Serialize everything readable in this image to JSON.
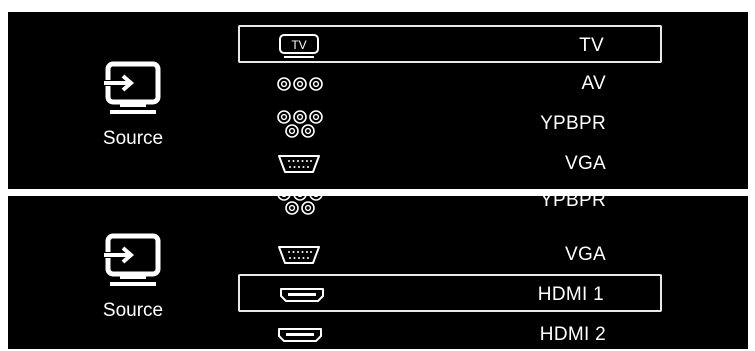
{
  "screens": [
    {
      "source_label": "Source",
      "items": [
        {
          "label": "TV",
          "icon": "tv-icon",
          "selected": true
        },
        {
          "label": "AV",
          "icon": "av-jacks-icon",
          "selected": false
        },
        {
          "label": "YPBPR",
          "icon": "ypbpr-jacks-icon",
          "selected": false
        },
        {
          "label": "VGA",
          "icon": "vga-port-icon",
          "selected": false
        }
      ]
    },
    {
      "source_label": "Source",
      "items": [
        {
          "label": "YPBPR",
          "icon": "ypbpr-jacks-icon",
          "selected": false
        },
        {
          "label": "VGA",
          "icon": "vga-port-icon",
          "selected": false
        },
        {
          "label": "HDMI 1",
          "icon": "hdmi-port-icon",
          "selected": true
        },
        {
          "label": "HDMI 2",
          "icon": "hdmi-port-icon",
          "selected": false
        }
      ]
    }
  ],
  "colors": {
    "background": "#000000",
    "text": "#ffffff",
    "highlight_border": "#e9e9e9"
  }
}
